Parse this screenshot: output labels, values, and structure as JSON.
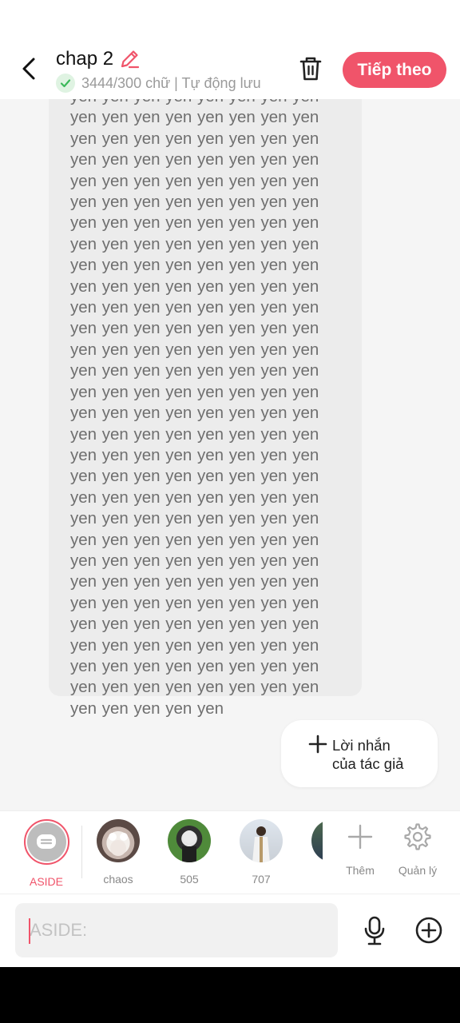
{
  "header": {
    "title": "chap 2",
    "meta": "3444/300 chữ | Tự động lưu",
    "next_label": "Tiếp theo"
  },
  "content": {
    "body_text": "yen yen yen yen yen yen yen yen yen yen yen yen yen yen yen yen yen yen yen yen yen yen yen yen yen yen yen yen yen yen yen yen yen yen yen yen yen yen yen yen yen yen yen yen yen yen yen yen yen yen yen yen yen yen yen yen yen yen yen yen yen yen yen yen yen yen yen yen yen yen yen yen yen yen yen yen yen yen yen yen yen yen yen yen yen yen yen yen yen yen yen yen yen yen yen yen yen yen yen yen yen yen yen yen yen yen yen yen yen yen yen yen yen yen yen yen yen yen yen yen yen yen yen yen yen yen yen yen yen yen yen yen yen yen yen yen yen yen yen yen yen yen yen yen yen yen yen yen yen yen yen yen yen yen yen yen yen yen yen yen yen yen yen yen yen yen yen yen yen yen yen yen yen yen yen yen yen yen yen yen yen yen yen yen yen yen yen yen yen yen yen yen yen yen yen yen yen yen yen yen yen yen yen yen yen yen yen yen yen yen yen yen yen yen yen yen yen yen yen yen yen yen yen yen yen yen yen yen yen yen yen yen yen yen yen yen yen",
    "author_note_label": "Lời nhắn\ncủa tác giả"
  },
  "characters": [
    {
      "label": "ASIDE",
      "icon": "chat-bubble-icon"
    },
    {
      "label": "chaos",
      "icon": "avatar"
    },
    {
      "label": "505",
      "icon": "avatar"
    },
    {
      "label": "707",
      "icon": "avatar"
    },
    {
      "label": "",
      "icon": "avatar"
    }
  ],
  "tools": {
    "add_label": "Thêm",
    "manage_label": "Quản lý"
  },
  "input": {
    "placeholder": "ASIDE:"
  },
  "colors": {
    "accent": "#f0546a",
    "bubble": "#ececec",
    "background": "#f5f5f5",
    "text_muted": "#6f6f6f"
  }
}
